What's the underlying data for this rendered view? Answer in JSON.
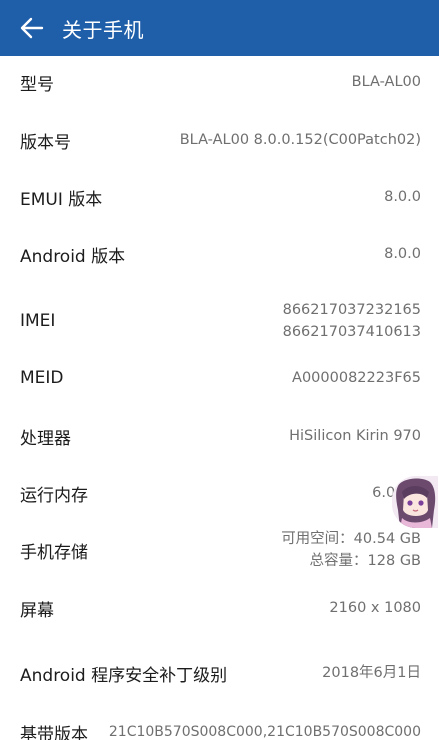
{
  "header": {
    "title": "关于手机",
    "icon": "back-arrow-icon",
    "color": "#1f5ea8"
  },
  "rows": [
    {
      "label": "型号",
      "values": [
        "BLA-AL00"
      ]
    },
    {
      "label": "版本号",
      "values": [
        "BLA-AL00 8.0.0.152(C00Patch02)"
      ]
    },
    {
      "label": "EMUI 版本",
      "values": [
        "8.0.0"
      ]
    },
    {
      "label": "Android 版本",
      "values": [
        "8.0.0"
      ]
    },
    {
      "label": "IMEI",
      "values": [
        "866217037232165",
        "866217037410613"
      ]
    },
    {
      "label": "MEID",
      "values": [
        "A0000082223F65"
      ]
    },
    {
      "label": "处理器",
      "values": [
        "HiSilicon Kirin 970"
      ]
    },
    {
      "label": "运行内存",
      "values": [
        "6.0 GB"
      ]
    },
    {
      "label": "手机存储",
      "values": [
        "可用空间：40.54  GB",
        "总容量：128  GB"
      ]
    },
    {
      "label": "屏幕",
      "values": [
        "2160 x 1080"
      ]
    },
    {
      "label": "Android 程序安全补丁级别",
      "values": [
        "2018年6月1日"
      ]
    },
    {
      "label": "基带版本",
      "values": [
        "21C10B570S008C000,21C10B570S008C000"
      ]
    }
  ],
  "floating_avatar": {
    "icon": "anime-avatar-icon"
  }
}
